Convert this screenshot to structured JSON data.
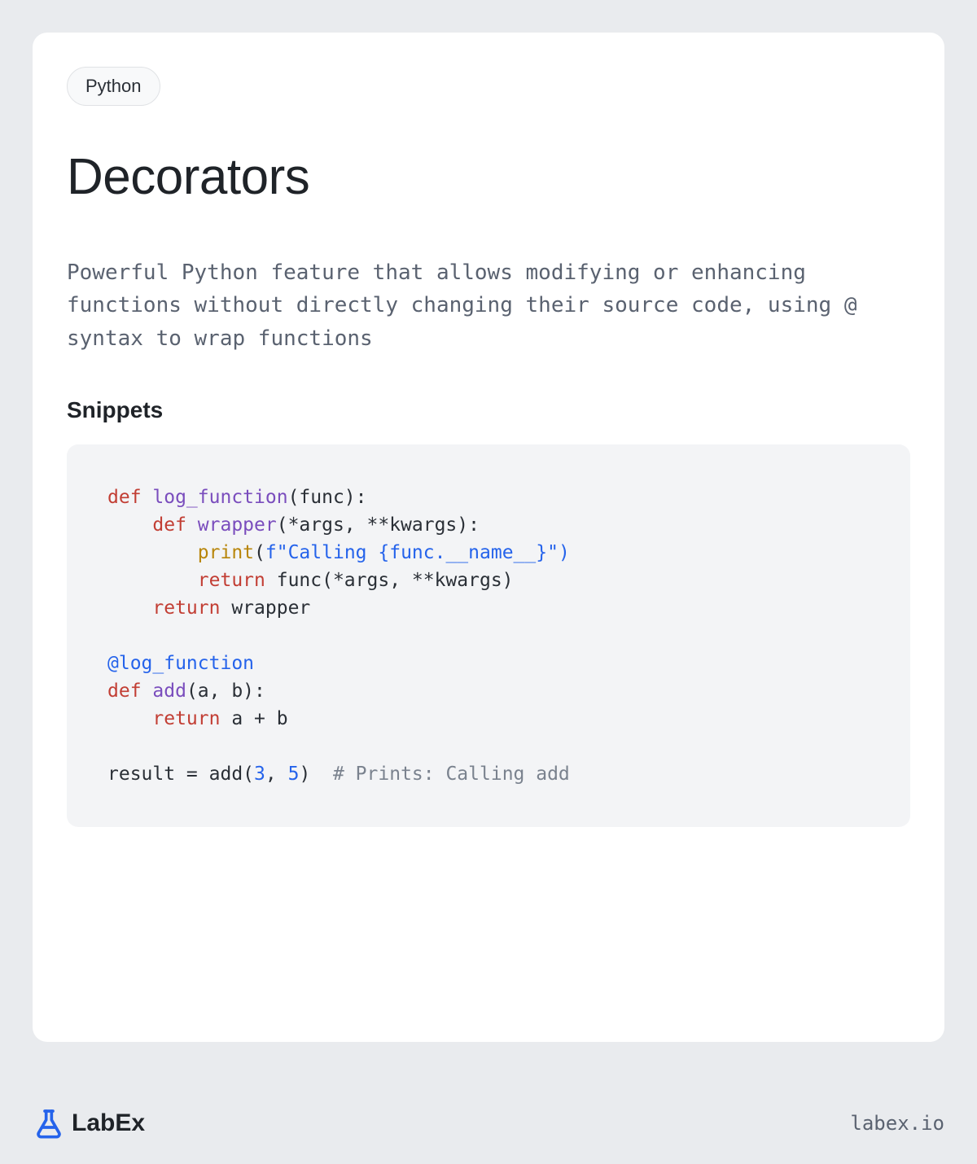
{
  "tag": "Python",
  "title": "Decorators",
  "description": "Powerful Python feature that allows modifying or enhancing functions without directly changing their source code, using @ syntax to wrap functions",
  "snippets_heading": "Snippets",
  "code": {
    "l1": {
      "def": "def ",
      "name": "log_function",
      "rest": "(func):"
    },
    "l2": {
      "def": "def ",
      "name": "wrapper",
      "rest": "(*args, **kwargs):"
    },
    "l3": {
      "print": "print",
      "open": "(",
      "f": "f\"Calling ",
      "interp": "{func.__name__}",
      "close": "\")"
    },
    "l4": {
      "ret": "return ",
      "rest": "func(*args, **kwargs)"
    },
    "l5": {
      "ret": "return ",
      "rest": "wrapper"
    },
    "l6": "@log_function",
    "l7": {
      "def": "def ",
      "name": "add",
      "rest": "(a, b):"
    },
    "l8": {
      "ret": "return ",
      "rest": "a + b"
    },
    "l9": {
      "pre": "result = add(",
      "n1": "3",
      "mid": ", ",
      "n2": "5",
      "post": ")  ",
      "com": "# Prints: Calling add"
    }
  },
  "brand": "LabEx",
  "site": "labex.io"
}
